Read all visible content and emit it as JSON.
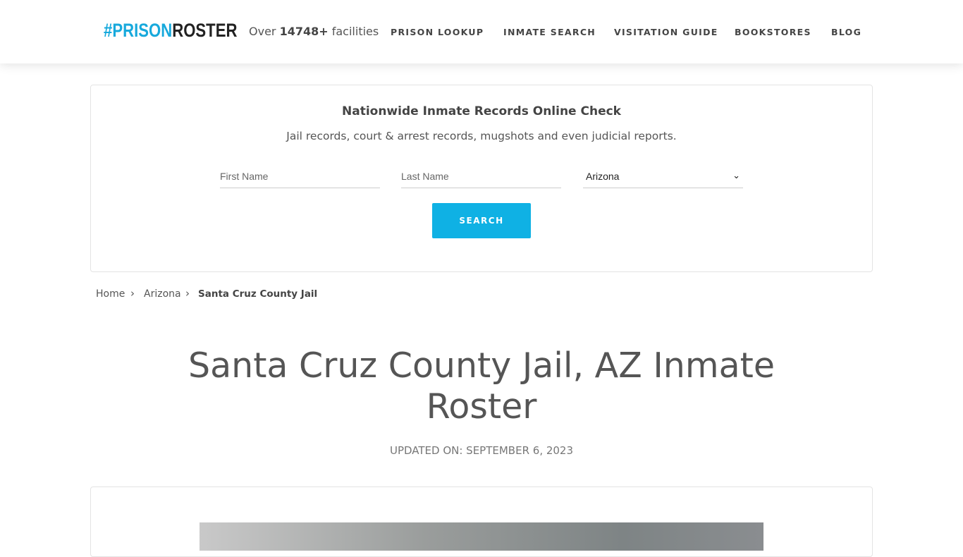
{
  "header": {
    "logo_hash": "#PRISON",
    "logo_rest": "ROSTER",
    "count_prefix": "Over ",
    "count_value": "14748+",
    "count_suffix": " facilities",
    "nav": [
      "PRISON LOOKUP",
      "INMATE SEARCH",
      "VISITATION GUIDE",
      "BOOKSTORES",
      "BLOG"
    ]
  },
  "search": {
    "title": "Nationwide Inmate Records Online Check",
    "subtitle": "Jail records, court & arrest records, mugshots and even judicial reports.",
    "first_placeholder": "First Name",
    "last_placeholder": "Last Name",
    "state": "Arizona",
    "button": "SEARCH"
  },
  "breadcrumb": [
    "Home",
    "Arizona",
    "Santa Cruz County Jail"
  ],
  "page": {
    "title": "Santa Cruz County Jail, AZ Inmate Roster",
    "updated": "UPDATED ON: SEPTEMBER 6, 2023"
  },
  "colors": {
    "accent": "#0fb1e4"
  }
}
